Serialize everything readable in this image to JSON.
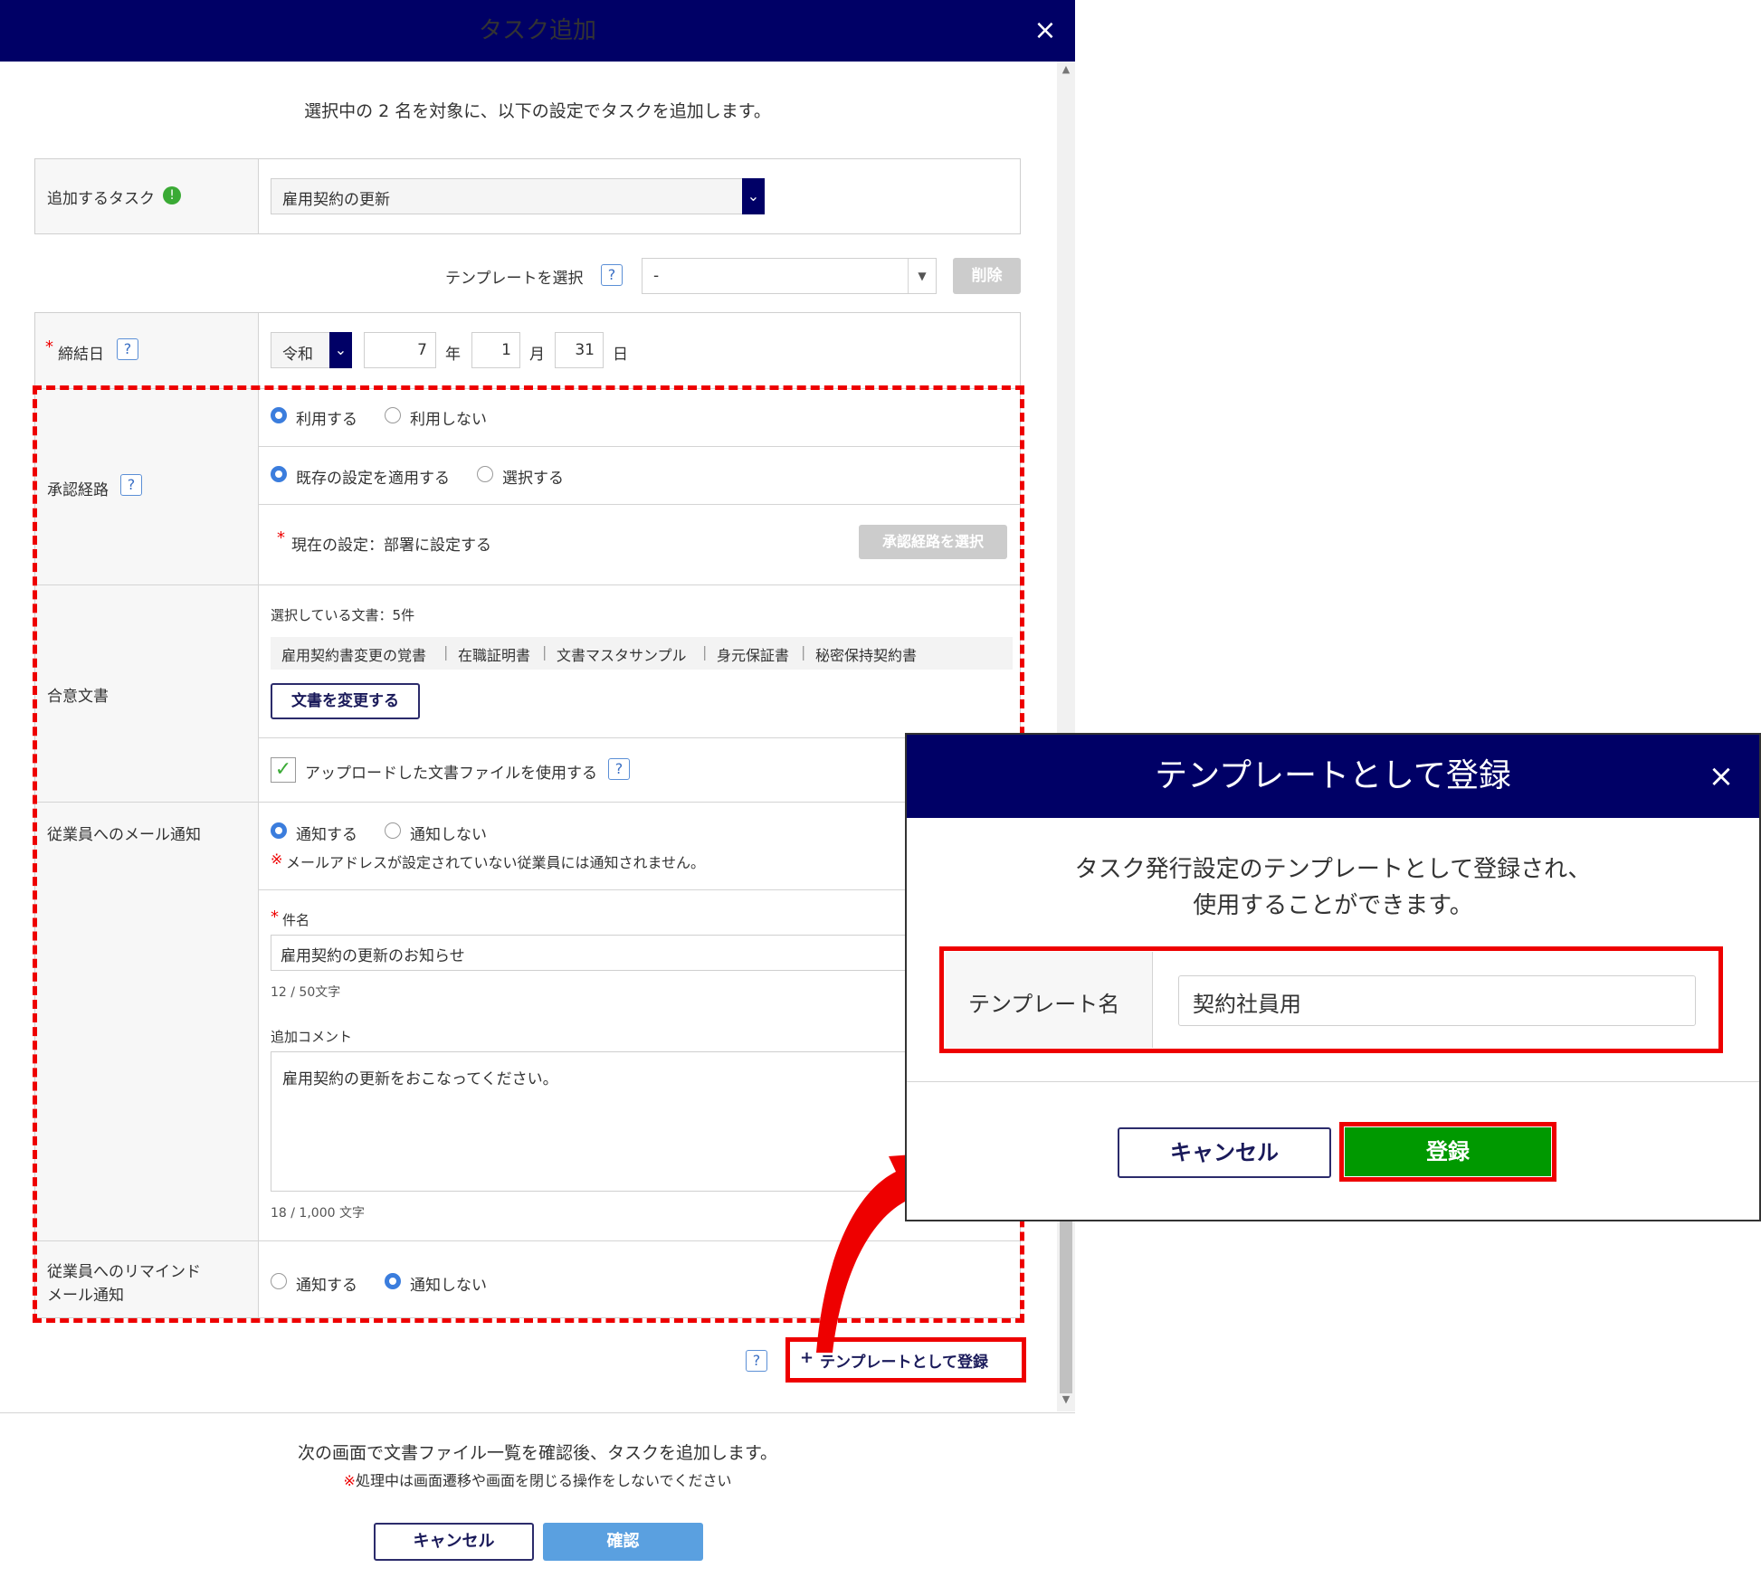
{
  "main": {
    "title": "タスク追加",
    "close": "×",
    "intro": "選択中の 2 名を対象に、以下の設定でタスクを追加します。",
    "task_label": "追加するタスク",
    "task_value": "雇用契約の更新",
    "template_label": "テンプレートを選択",
    "template_value": "-",
    "delete_button": "削除",
    "date_label": "締結日",
    "era": "令和",
    "year": "7",
    "year_unit": "年",
    "month": "1",
    "month_unit": "月",
    "day": "31",
    "day_unit": "日",
    "approval_label": "承認経路",
    "approval_use": "利用する",
    "approval_nouse": "利用しない",
    "approval_existing": "既存の設定を適用する",
    "approval_select": "選択する",
    "approval_current": "現在の設定：部署に設定する",
    "approval_select_button": "承認経路を選択",
    "agree_label": "合意文書",
    "docs_selected": "選択している文書：5件",
    "docs": [
      "雇用契約書変更の覚書",
      "在職証明書",
      "文書マスタサンプル",
      "身元保証書",
      "秘密保持契約書"
    ],
    "doc_sep": "|",
    "change_docs_button": "文書を変更する",
    "use_uploaded": "アップロードした文書ファイルを使用する",
    "mail_label": "従業員へのメール通知",
    "notify": "通知する",
    "no_notify": "通知しない",
    "mail_note_mark": "※",
    "mail_note": "メールアドレスが設定されていない従業員には通知されません。",
    "subject_label": "件名",
    "subject_value": "雇用契約の更新のお知らせ",
    "subject_count": "12 / 50文字",
    "comment_label": "追加コメント",
    "comment_value": "雇用契約の更新をおこなってください。",
    "comment_count": "18 / 1,000 文字",
    "remind_label_1": "従業員へのリマインド",
    "remind_label_2": "メール通知",
    "remind_notify": "通知する",
    "remind_no_notify": "通知しない",
    "register_template_link": "テンプレートとして登録",
    "plus": "+",
    "footer_text": "次の画面で文書ファイル一覧を確認後、タスクを追加します。",
    "footer_warn_mark": "※",
    "footer_warn": "処理中は画面遷移や画面を閉じる操作をしないでください",
    "cancel_button": "キャンセル",
    "confirm_button": "確認",
    "help": "?",
    "info": "!",
    "req": "*"
  },
  "dialog": {
    "title": "テンプレートとして登録",
    "close": "×",
    "message_1": "タスク発行設定のテンプレートとして登録され、",
    "message_2": "使用することができます。",
    "name_label": "テンプレート名",
    "name_value": "契約社員用",
    "cancel_button": "キャンセル",
    "register_button": "登録"
  },
  "colors": {
    "header": "#000066",
    "accent_red": "#ee0000",
    "register_green": "#009900",
    "confirm_blue": "#5aa0e0",
    "disabled_gray": "#cccccc"
  }
}
